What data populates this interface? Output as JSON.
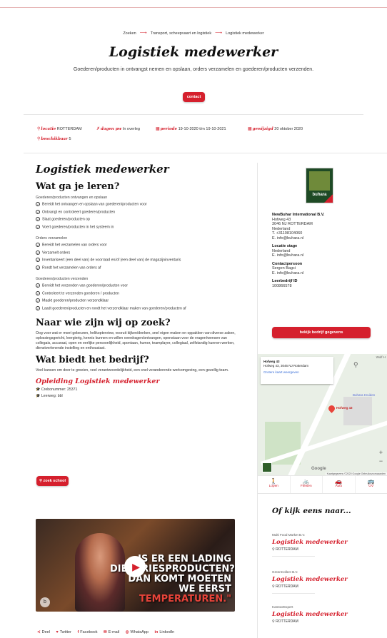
{
  "breadcrumb": [
    "Zoeken",
    "Transport, scheepvaart en logistiek",
    "Logistiek medewerker"
  ],
  "page_title": "Logistiek medewerker",
  "subtitle": "Goederen/producten in ontvangst nemen en opslaan, orders verzamelen en goederen/producten verzenden.",
  "contact_button": "contact",
  "meta": {
    "locatie_label": "locatie",
    "locatie_value": "ROTTERDAM",
    "dagen_label": "dagen pw",
    "dagen_value": "In overleg",
    "periode_label": "periode",
    "periode_value": "19-10-2020 t/m 19-10-2021",
    "gewijzigd_label": "gewijzigd",
    "gewijzigd_value": "20 oktober 2020",
    "beschikbaar_label": "beschikbaar",
    "beschikbaar_value": "5"
  },
  "main": {
    "heading": "Logistiek medewerker",
    "leren_heading": "Wat ga je leren?",
    "groups": [
      {
        "title": "Goederen/producten ontvangen en opslaan",
        "items": [
          "Bereidt het ontvangen en opslaan van goederen/producten voor",
          "Ontvangt en controleert goederen/producten",
          "Slaat goederen/producten op",
          "Voert goederen/producten in het systeem in"
        ]
      },
      {
        "title": "Orders verzamelen",
        "items": [
          "Bereidt het verzamelen van orders voor",
          "Verzamelt orders",
          "Inventariseert (een deel van) de voorraad en/of (een deel van) de magazijninventaris",
          "Rondt het verzamelen van orders af"
        ]
      },
      {
        "title": "Goederen/producten verzenden",
        "items": [
          "Bereidt het verzenden van goederen/producten voor",
          "Controleert te verzenden goederen / producten",
          "Maakt goederen/producten verzendklaar",
          "Laadt goederen/producten en rondt het verzendklaar maken van goederen/producten af"
        ]
      }
    ],
    "zoek_heading": "Naar wie zijn wij op zoek?",
    "zoek_text": "Oog voor wat er moet gebeuren, helikopterview, vooruit kijken/denken, snel eigen maken en oppakken van diverse zaken, oplossingsgericht, leergierig, kennis kunnen en willen overdragen/ontvangen, openstaan voor de vragen/wensen van collegais, accuraat, open en eerlijke persoonlijkheid, spontaan, humor, teamplayer, collegiaal, zelfstandig kunnen werken, dienstverlenende instelling en enthousiast.",
    "biedt_heading": "Wat biedt het bedrijf?",
    "biedt_text": "Veel kansen om door te groeien, veel verantwoordelijkheid, een snel veranderende werkomgeving, een gezellig team.",
    "opleiding_title": "Opleiding Logistiek medewerker",
    "crebo": "Crebonummer: 25371",
    "leerweg": "Leerweg: bbl",
    "zoek_school_button": "zoek school"
  },
  "video": {
    "caption_white": "IS ER EEN LADING DIEPVRIESPRODUCTEN? DAN KOMT MOETEN WE EERST",
    "caption_red": "TEMPERATUREN.\""
  },
  "share": [
    "Deel",
    "Twitter",
    "Facebook",
    "E-mail",
    "WhatsApp",
    "LinkedIn"
  ],
  "company": {
    "logo_text": "buhara",
    "name": "NewBuhar International B.V.",
    "address": [
      "Hofweg 43",
      "3046 NJ ROTTERDAM",
      "Nederland",
      "T. +31108104060",
      "E. info@buhara.nl"
    ],
    "stage_label": "Locatie stage",
    "stage": [
      "Nederland",
      "E. info@buhara.nl"
    ],
    "contact_label": "Contactpersoon",
    "contact": [
      "Sergen Bagci",
      "E. info@buhara.nl"
    ],
    "leerbedrijf_label": "Leerbedrijf ID",
    "leerbedrijf_id": "100866578",
    "view_button": "bekijk bedrijf gegevens"
  },
  "map": {
    "card_title": "Hofweg 43",
    "card_addr": "Hofweg 43, 3046 NJ Rotterdam",
    "card_link": "Grotere kaart weergeven",
    "pin_label": "Hofweg 43",
    "poi": "Buhara Kruiden",
    "corner_label": "Wolf H",
    "google": "Google",
    "attribution": "Kaartgegevens ©2020 Google  Gebruiksvoorwaarden"
  },
  "transport": [
    "Lopen",
    "Fietsen",
    "Auto",
    "OV"
  ],
  "suggest_heading": "Of kijk eens naar...",
  "suggestions": [
    {
      "company": "Multi Food Market B.V.",
      "title": "Logistiek medewerker",
      "location": "ROTTERDAM"
    },
    {
      "company": "GreenCollect B.V.",
      "title": "Logistiek medewerker",
      "location": "ROTTERDAM"
    },
    {
      "company": "KantoorExpert",
      "title": "Logistiek medewerker",
      "location": "ROTTERDAM"
    }
  ]
}
